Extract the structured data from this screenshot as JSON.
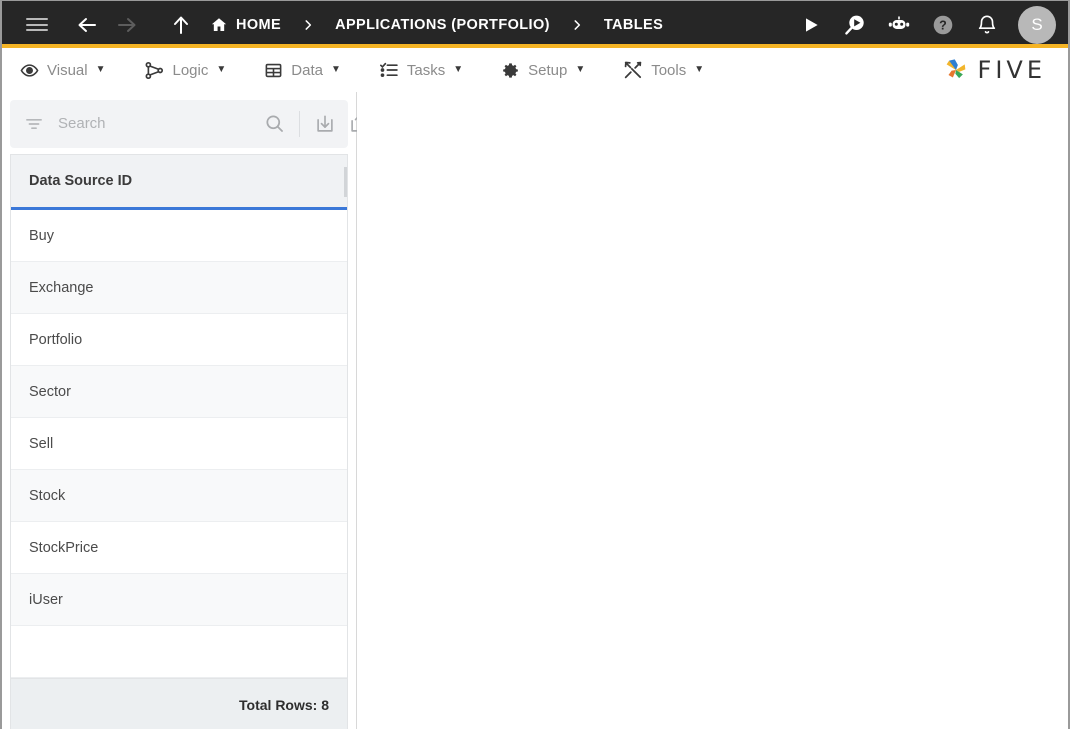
{
  "colors": {
    "accent_yellow": "#f5b425",
    "header_dark": "#262626",
    "grid_header_underline": "#3b78d8",
    "add_button": "#f8b62c",
    "avatar_bg": "#b8b8b8"
  },
  "topbar": {
    "menu_icon": "hamburger-icon",
    "back_icon": "arrow-left-icon",
    "forward_icon": "arrow-right-icon",
    "up_icon": "arrow-up-icon",
    "breadcrumbs": [
      {
        "label": "HOME",
        "icon": "home-icon"
      },
      {
        "label": "APPLICATIONS (PORTFOLIO)",
        "icon": ""
      },
      {
        "label": "TABLES",
        "icon": ""
      }
    ],
    "separator": "›",
    "actions": [
      {
        "name": "run-icon",
        "title": "Run"
      },
      {
        "name": "run-search-icon",
        "title": "Search Run"
      },
      {
        "name": "robot-icon",
        "title": "Assistant"
      },
      {
        "name": "help-icon",
        "title": "Help"
      },
      {
        "name": "bell-icon",
        "title": "Notifications"
      }
    ],
    "avatar_initial": "S"
  },
  "menubar": {
    "items": [
      {
        "label": "Visual",
        "icon": "eye-icon"
      },
      {
        "label": "Logic",
        "icon": "flow-nodes-icon"
      },
      {
        "label": "Data",
        "icon": "table-grid-icon"
      },
      {
        "label": "Tasks",
        "icon": "checklist-icon"
      },
      {
        "label": "Setup",
        "icon": "gear-icon"
      },
      {
        "label": "Tools",
        "icon": "tools-icon"
      }
    ],
    "caret": "▼",
    "brand": "FIVE"
  },
  "panel": {
    "search": {
      "placeholder": "Search",
      "value": "",
      "filter_icon": "filter-icon",
      "search_icon": "search-icon",
      "import_icon": "import-icon",
      "export_icon": "export-icon",
      "add_label": "+"
    },
    "grid": {
      "columns": [
        "Data Source ID"
      ],
      "rows": [
        "Buy",
        "Exchange",
        "Portfolio",
        "Sector",
        "Sell",
        "Stock",
        "StockPrice",
        "iUser"
      ],
      "footer_label": "Total Rows: 8"
    }
  }
}
